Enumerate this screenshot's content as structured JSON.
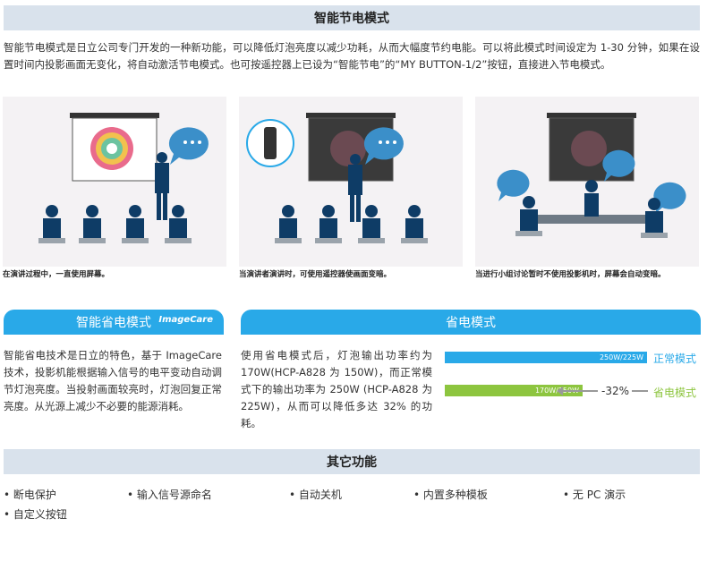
{
  "section1": {
    "title": "智能节电模式",
    "intro": "智能节电模式是日立公司专门开发的一种新功能，可以降低灯泡亮度以减少功耗，从而大幅度节约电能。可以将此模式时间设定为 1-30 分钟，如果在设置时间内投影画面无变化，将自动激活节电模式。也可按遥控器上已设为“智能节电”的“MY BUTTON-1/2”按钮，直接进入节电模式。",
    "captions": [
      "在演讲过程中，一直使用屏幕。",
      "当演讲者演讲时，可使用遥控器使画面变暗。",
      "当进行小组讨论暂时不使用投影机时，屏幕会自动变暗。"
    ]
  },
  "smart_save": {
    "title": "智能省电模式",
    "logo_text": "ImageCare",
    "body": "智能省电技术是日立的特色，基于 ImageCare 技术，投影机能根据输入信号的电平变动自动调节灯泡亮度。当投射画面较亮时，灯泡回复正常亮度。从光源上减少不必要的能源消耗。"
  },
  "eco_mode": {
    "title": "省电模式",
    "body": "使用省电模式后，灯泡输出功率约为 170W(HCP-A828 为 150W)，而正常模式下的输出功率为 250W (HCP-A828 为 225W)，从而可以降低多达 32% 的功耗。",
    "normal_bar_label": "250W/225W",
    "normal_label": "正常模式",
    "eco_bar_label": "170W/150W",
    "eco_label": "省电模式",
    "reduction": "-32%",
    "normal_fraction": 1.0,
    "eco_fraction": 0.68,
    "normal_color": "#29a9e8",
    "eco_color": "#8dc53f"
  },
  "other": {
    "title": "其它功能",
    "features": [
      "断电保护",
      "输入信号源命名",
      "自动关机",
      "内置多种模板",
      "无 PC 演示",
      "自定义按钮"
    ]
  }
}
